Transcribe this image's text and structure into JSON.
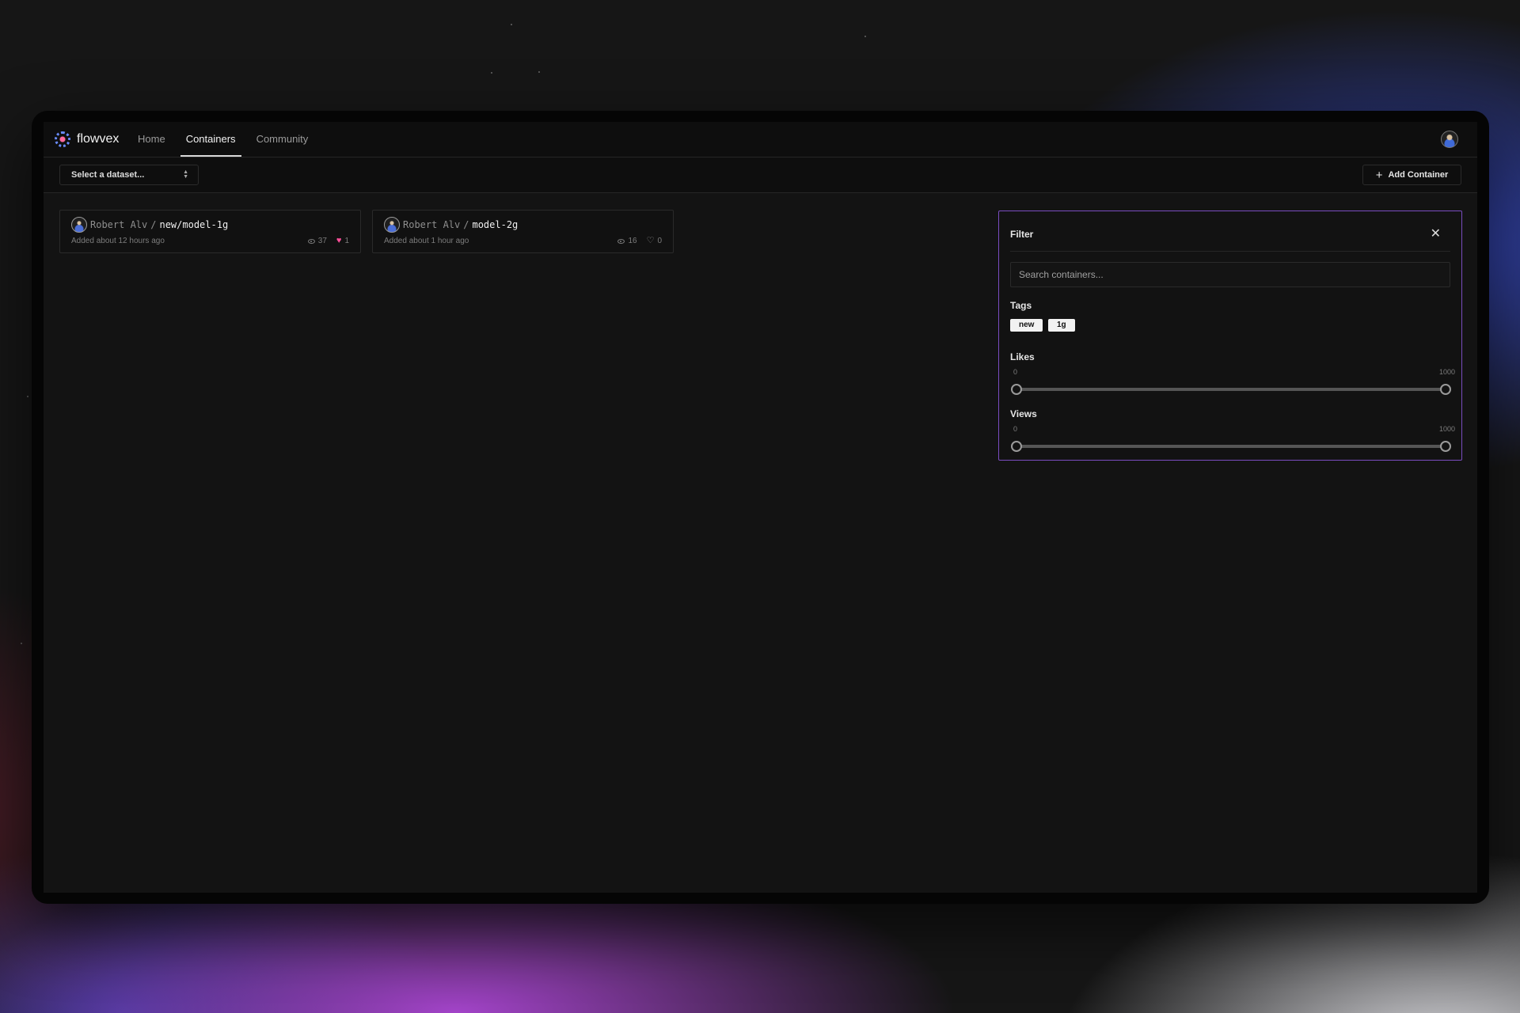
{
  "nav": {
    "brand": "flowvex",
    "links": [
      {
        "label": "Home",
        "active": false
      },
      {
        "label": "Containers",
        "active": true
      },
      {
        "label": "Community",
        "active": false
      }
    ]
  },
  "toolbar": {
    "dataset_placeholder": "Select a dataset...",
    "add_label": "Add Container"
  },
  "cards": [
    {
      "owner": "Robert Alv",
      "separator": "/",
      "name": "new/model-1g",
      "added": "Added about 12 hours ago",
      "views": "37",
      "likes": "1",
      "liked": true
    },
    {
      "owner": "Robert Alv",
      "separator": "/",
      "name": "model-2g",
      "added": "Added about 1 hour ago",
      "views": "16",
      "likes": "0",
      "liked": false
    }
  ],
  "filter": {
    "title": "Filter",
    "search_placeholder": "Search containers...",
    "tags_label": "Tags",
    "tags": [
      "new",
      "1g"
    ],
    "likes": {
      "label": "Likes",
      "min_label": "0",
      "max_label": "1000",
      "low": 0,
      "high": 1000,
      "min": 0,
      "max": 1000
    },
    "views": {
      "label": "Views",
      "min_label": "0",
      "max_label": "1000",
      "low": 0,
      "high": 1000,
      "min": 0,
      "max": 1000
    }
  },
  "colors": {
    "accent_border": "#7a4dc0",
    "like_active": "#ff4f9a"
  },
  "icons": {
    "brand": "flowvex-logo-icon",
    "close": "close-icon",
    "views": "eye-icon",
    "likes": "heart-icon",
    "add": "plus-icon",
    "select": "chevron-up-down-icon"
  }
}
